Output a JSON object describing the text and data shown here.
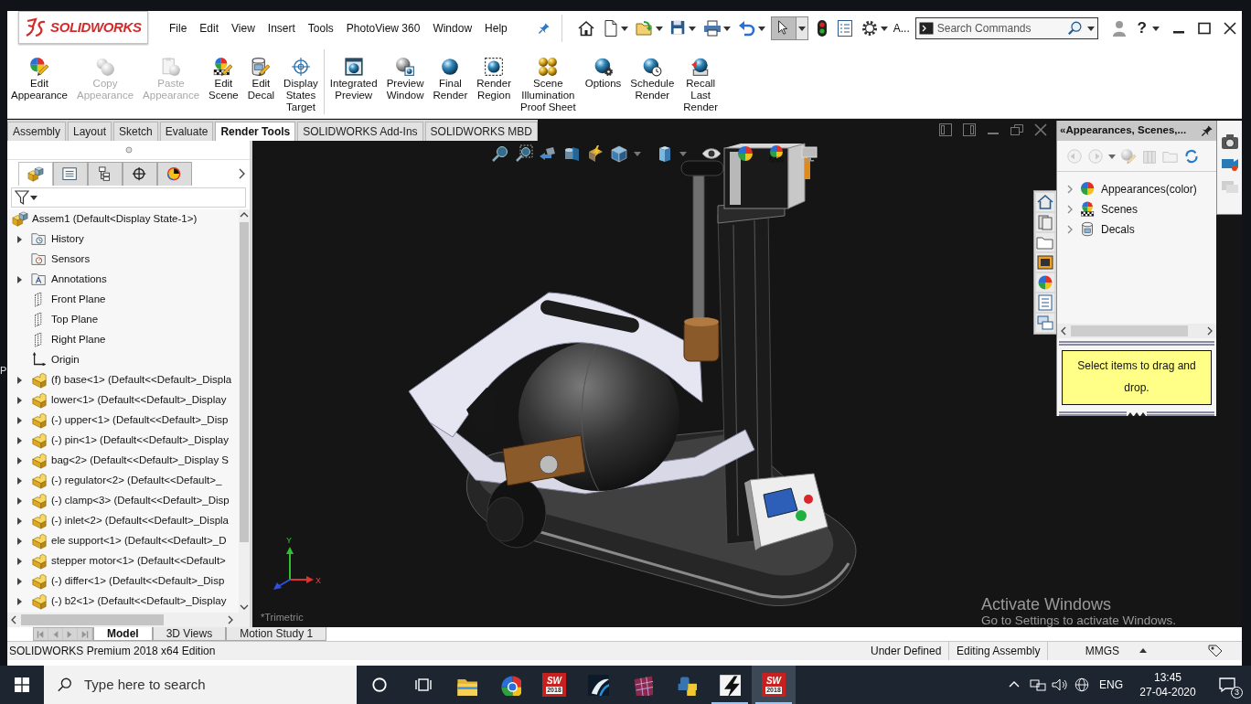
{
  "desktop_edge": {
    "text": "P"
  },
  "window": {
    "logo": "SOLIDWORKS",
    "menu": [
      "File",
      "Edit",
      "View",
      "Insert",
      "Tools",
      "PhotoView 360",
      "Window",
      "Help"
    ],
    "truncated_label": "A...",
    "search": {
      "placeholder": "Search Commands"
    },
    "help": "?"
  },
  "ribbon": {
    "groups": [
      {
        "commands": [
          {
            "label": "Edit\nAppearance",
            "disabled": false
          },
          {
            "label": "Copy\nAppearance",
            "disabled": true
          },
          {
            "label": "Paste\nAppearance",
            "disabled": true
          },
          {
            "label": "Edit\nScene",
            "disabled": false
          },
          {
            "label": "Edit\nDecal",
            "disabled": false
          },
          {
            "label": "Display\nStates\nTarget",
            "disabled": false
          }
        ]
      },
      {
        "commands": [
          {
            "label": "Integrated\nPreview",
            "disabled": false
          },
          {
            "label": "Preview\nWindow",
            "disabled": false
          },
          {
            "label": "Final\nRender",
            "disabled": false
          },
          {
            "label": "Render\nRegion",
            "disabled": false
          },
          {
            "label": "Scene\nIllumination\nProof Sheet",
            "disabled": false
          },
          {
            "label": "Options",
            "disabled": false
          },
          {
            "label": "Schedule\nRender",
            "disabled": false
          },
          {
            "label": "Recall\nLast\nRender",
            "disabled": false
          }
        ]
      }
    ]
  },
  "tabs": [
    {
      "label": "Assembly",
      "selected": false
    },
    {
      "label": "Layout",
      "selected": false
    },
    {
      "label": "Sketch",
      "selected": false
    },
    {
      "label": "Evaluate",
      "selected": false
    },
    {
      "label": "Render Tools",
      "selected": true
    },
    {
      "label": "SOLIDWORKS Add-Ins",
      "selected": false
    },
    {
      "label": "SOLIDWORKS MBD",
      "selected": false
    }
  ],
  "feature_manager": {
    "tabs": [
      {
        "selected": true
      },
      {
        "selected": false
      },
      {
        "selected": false
      },
      {
        "selected": false
      },
      {
        "selected": false
      }
    ],
    "tree": [
      {
        "label": "Assem1 (Default<Display State-1>)",
        "kind": "assembly",
        "children": [
          {
            "label": "History",
            "kind": "history",
            "expanded": false
          },
          {
            "label": "Sensors",
            "kind": "sensors"
          },
          {
            "label": "Annotations",
            "kind": "annotations",
            "expanded": false
          },
          {
            "label": "Front Plane",
            "kind": "plane"
          },
          {
            "label": "Top Plane",
            "kind": "plane"
          },
          {
            "label": "Right Plane",
            "kind": "plane"
          },
          {
            "label": "Origin",
            "kind": "origin"
          },
          {
            "label": "(f) base<1> (Default<<Default>_Displa",
            "kind": "part",
            "expanded": false
          },
          {
            "label": "lower<1> (Default<<Default>_Display",
            "kind": "part",
            "expanded": false
          },
          {
            "label": "(-) upper<1> (Default<<Default>_Disp",
            "kind": "part",
            "expanded": false
          },
          {
            "label": "(-) pin<1> (Default<<Default>_Display",
            "kind": "part",
            "expanded": false
          },
          {
            "label": "bag<2> (Default<<Default>_Display S",
            "kind": "part",
            "expanded": false
          },
          {
            "label": "(-) regulator<2> (Default<<Default>_",
            "kind": "part",
            "expanded": false
          },
          {
            "label": "(-) clamp<3> (Default<<Default>_Disp",
            "kind": "part",
            "expanded": false
          },
          {
            "label": "(-) inlet<2> (Default<<Default>_Displa",
            "kind": "part",
            "expanded": false
          },
          {
            "label": "ele support<1> (Default<<Default>_D",
            "kind": "part",
            "expanded": false
          },
          {
            "label": "stepper motor<1> (Default<<Default>",
            "kind": "part",
            "expanded": false
          },
          {
            "label": "(-) differ<1> (Default<<Default>_Disp",
            "kind": "part",
            "expanded": false
          },
          {
            "label": "(-) b2<1> (Default<<Default>_Display",
            "kind": "part",
            "expanded": false
          }
        ]
      }
    ]
  },
  "viewport": {
    "view_name": "*Trimetric",
    "triad": {
      "labels": [
        "Y",
        "X"
      ]
    }
  },
  "task_pane": {
    "title": "«Appearances, Scenes,...",
    "items": [
      {
        "label": "Appearances(color)",
        "expanded": false
      },
      {
        "label": "Scenes",
        "expanded": false
      },
      {
        "label": "Decals",
        "expanded": false
      }
    ],
    "hint": "Select items to drag and drop."
  },
  "model_tabs": [
    {
      "label": "Model",
      "selected": true
    },
    {
      "label": "3D Views",
      "selected": false
    },
    {
      "label": "Motion Study 1",
      "selected": false
    }
  ],
  "status_bar": {
    "edition": "SOLIDWORKS Premium 2018 x64 Edition",
    "fields": [
      "Under Defined",
      "Editing Assembly",
      "MMGS"
    ]
  },
  "os_notice": {
    "title": "Activate Windows",
    "subtitle": "Go to Settings to activate Windows."
  },
  "taskbar": {
    "search": {
      "placeholder": "Type here to search"
    },
    "apps": [
      {
        "running": false,
        "selected": false
      },
      {
        "running": false,
        "selected": false
      },
      {
        "label": "SW",
        "caption": "2018",
        "running": false,
        "selected": false
      },
      {
        "running": false,
        "selected": false
      },
      {
        "running": false,
        "selected": false
      },
      {
        "running": false,
        "selected": false
      },
      {
        "running": true,
        "selected": false
      },
      {
        "label": "SW",
        "caption": "2018",
        "running": true,
        "selected": true
      }
    ],
    "language": "ENG",
    "time": "13:45",
    "date": "27-04-2020",
    "notifications": "3"
  }
}
